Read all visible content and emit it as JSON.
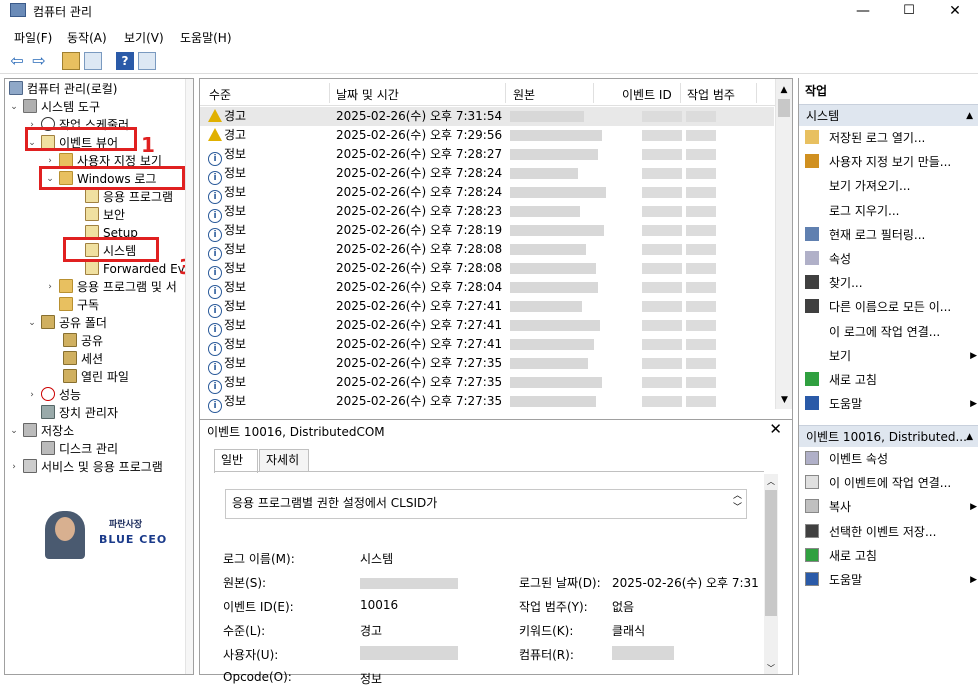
{
  "window": {
    "title": "컴퓨터 관리"
  },
  "menu": [
    "파일(F)",
    "동작(A)",
    "보기(V)",
    "도움말(H)"
  ],
  "tree": {
    "root": "컴퓨터 관리(로컬)",
    "system_tools": "시스템 도구",
    "task_scheduler": "작업 스케줄러",
    "event_viewer": "이벤트 뷰어",
    "custom_views": "사용자 지정 보기",
    "windows_logs": "Windows 로그",
    "app": "응용 프로그램",
    "security": "보안",
    "setup": "Setup",
    "system": "시스템",
    "forwarded": "Forwarded Eve",
    "app_svc_logs": "응용 프로그램 및 서",
    "subscriptions": "구독",
    "shared_folders": "공유 폴더",
    "shares": "공유",
    "sessions": "세션",
    "open_files": "열린 파일",
    "performance": "성능",
    "device_manager": "장치 관리자",
    "storage": "저장소",
    "disk_mgmt": "디스크 관리",
    "services_apps": "서비스 및 응용 프로그램"
  },
  "annotations": {
    "n1": "1",
    "n2": "2",
    "n3": "3"
  },
  "watermark": {
    "line1": "파란사장",
    "line2": "BLUE CEO"
  },
  "grid": {
    "headers": {
      "level": "수준",
      "datetime": "날짜 및 시간",
      "source": "원본",
      "event_id": "이벤트 ID",
      "category": "작업 범주"
    },
    "rows": [
      {
        "level": "경고",
        "type": "warn",
        "datetime": "2025-02-26(수) 오후 7:31:54"
      },
      {
        "level": "경고",
        "type": "warn",
        "datetime": "2025-02-26(수) 오후 7:29:56"
      },
      {
        "level": "정보",
        "type": "info",
        "datetime": "2025-02-26(수) 오후 7:28:27"
      },
      {
        "level": "정보",
        "type": "info",
        "datetime": "2025-02-26(수) 오후 7:28:24"
      },
      {
        "level": "정보",
        "type": "info",
        "datetime": "2025-02-26(수) 오후 7:28:24"
      },
      {
        "level": "정보",
        "type": "info",
        "datetime": "2025-02-26(수) 오후 7:28:23"
      },
      {
        "level": "정보",
        "type": "info",
        "datetime": "2025-02-26(수) 오후 7:28:19"
      },
      {
        "level": "정보",
        "type": "info",
        "datetime": "2025-02-26(수) 오후 7:28:08"
      },
      {
        "level": "정보",
        "type": "info",
        "datetime": "2025-02-26(수) 오후 7:28:08"
      },
      {
        "level": "정보",
        "type": "info",
        "datetime": "2025-02-26(수) 오후 7:28:04"
      },
      {
        "level": "정보",
        "type": "info",
        "datetime": "2025-02-26(수) 오후 7:27:41"
      },
      {
        "level": "정보",
        "type": "info",
        "datetime": "2025-02-26(수) 오후 7:27:41"
      },
      {
        "level": "정보",
        "type": "info",
        "datetime": "2025-02-26(수) 오후 7:27:41"
      },
      {
        "level": "정보",
        "type": "info",
        "datetime": "2025-02-26(수) 오후 7:27:35"
      },
      {
        "level": "정보",
        "type": "info",
        "datetime": "2025-02-26(수) 오후 7:27:35"
      },
      {
        "level": "정보",
        "type": "info",
        "datetime": "2025-02-26(수) 오후 7:27:35"
      }
    ]
  },
  "detail": {
    "header": "이벤트 10016, DistributedCOM",
    "tab_general": "일반",
    "tab_details": "자세히",
    "description": "응용 프로그램별 권한 설정에서 CLSID가",
    "log_name_label": "로그 이름(M):",
    "log_name": "시스템",
    "source_label": "원본(S):",
    "logged_label": "로그된 날짜(D):",
    "logged": "2025-02-26(수) 오후 7:31",
    "event_id_label": "이벤트 ID(E):",
    "event_id": "10016",
    "category_label": "작업 범주(Y):",
    "category": "없음",
    "level_label": "수준(L):",
    "level": "경고",
    "keywords_label": "키워드(K):",
    "keywords": "클래식",
    "user_label": "사용자(U):",
    "computer_label": "컴퓨터(R):",
    "opcode_label": "Opcode(O):",
    "opcode": "정보"
  },
  "actions": {
    "title": "작업",
    "sec1": "시스템",
    "items1": [
      "저장된 로그 열기...",
      "사용자 지정 보기 만들...",
      "보기 가져오기...",
      "로그 지우기...",
      "현재 로그 필터링...",
      "속성",
      "찾기...",
      "다른 이름으로 모든 이...",
      "이 로그에 작업 연결...",
      "보기",
      "새로 고침",
      "도움말"
    ],
    "sec2": "이벤트 10016, Distributed...",
    "items2": [
      "이벤트 속성",
      "이 이벤트에 작업 연결...",
      "복사",
      "선택한 이벤트 저장...",
      "새로 고침",
      "도움말"
    ]
  }
}
